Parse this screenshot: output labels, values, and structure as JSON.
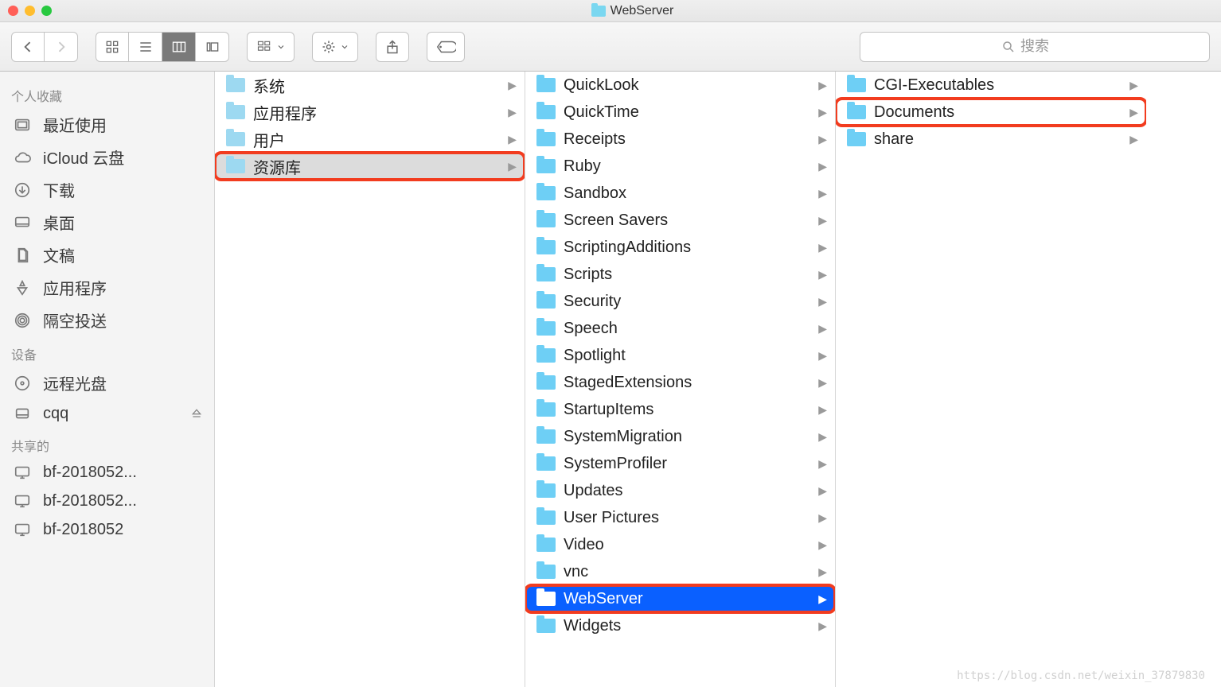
{
  "window_title": "WebServer",
  "toolbar": {
    "search_placeholder": "搜索"
  },
  "sidebar": {
    "sections": [
      {
        "header": "个人收藏",
        "items": [
          {
            "icon": "recent",
            "label": "最近使用"
          },
          {
            "icon": "icloud",
            "label": "iCloud 云盘"
          },
          {
            "icon": "download",
            "label": "下载"
          },
          {
            "icon": "desktop",
            "label": "桌面"
          },
          {
            "icon": "documents",
            "label": "文稿"
          },
          {
            "icon": "apps",
            "label": "应用程序"
          },
          {
            "icon": "airdrop",
            "label": "隔空投送"
          }
        ]
      },
      {
        "header": "设备",
        "items": [
          {
            "icon": "disc",
            "label": "远程光盘"
          },
          {
            "icon": "disk",
            "label": "cqq",
            "eject": true
          }
        ]
      },
      {
        "header": "共享的",
        "items": [
          {
            "icon": "monitor",
            "label": "bf-2018052..."
          },
          {
            "icon": "monitor",
            "label": "bf-2018052..."
          },
          {
            "icon": "monitor",
            "label": "bf-2018052"
          }
        ]
      }
    ]
  },
  "columns": [
    {
      "items": [
        {
          "label": "系统",
          "iconVariant": "sys"
        },
        {
          "label": "应用程序",
          "iconVariant": "sys"
        },
        {
          "label": "用户",
          "iconVariant": "sys"
        },
        {
          "label": "资源库",
          "iconVariant": "sys",
          "activePath": true,
          "highlight": true
        }
      ]
    },
    {
      "items": [
        {
          "label": "QuickLook"
        },
        {
          "label": "QuickTime"
        },
        {
          "label": "Receipts"
        },
        {
          "label": "Ruby"
        },
        {
          "label": "Sandbox"
        },
        {
          "label": "Screen Savers"
        },
        {
          "label": "ScriptingAdditions"
        },
        {
          "label": "Scripts"
        },
        {
          "label": "Security"
        },
        {
          "label": "Speech"
        },
        {
          "label": "Spotlight"
        },
        {
          "label": "StagedExtensions"
        },
        {
          "label": "StartupItems"
        },
        {
          "label": "SystemMigration"
        },
        {
          "label": "SystemProfiler"
        },
        {
          "label": "Updates"
        },
        {
          "label": "User Pictures"
        },
        {
          "label": "Video"
        },
        {
          "label": "vnc"
        },
        {
          "label": "WebServer",
          "selected": true,
          "highlight": true
        },
        {
          "label": "Widgets"
        }
      ]
    },
    {
      "items": [
        {
          "label": "CGI-Executables"
        },
        {
          "label": "Documents",
          "highlight": true
        },
        {
          "label": "share"
        }
      ]
    }
  ],
  "watermark": "https://blog.csdn.net/weixin_37879830"
}
